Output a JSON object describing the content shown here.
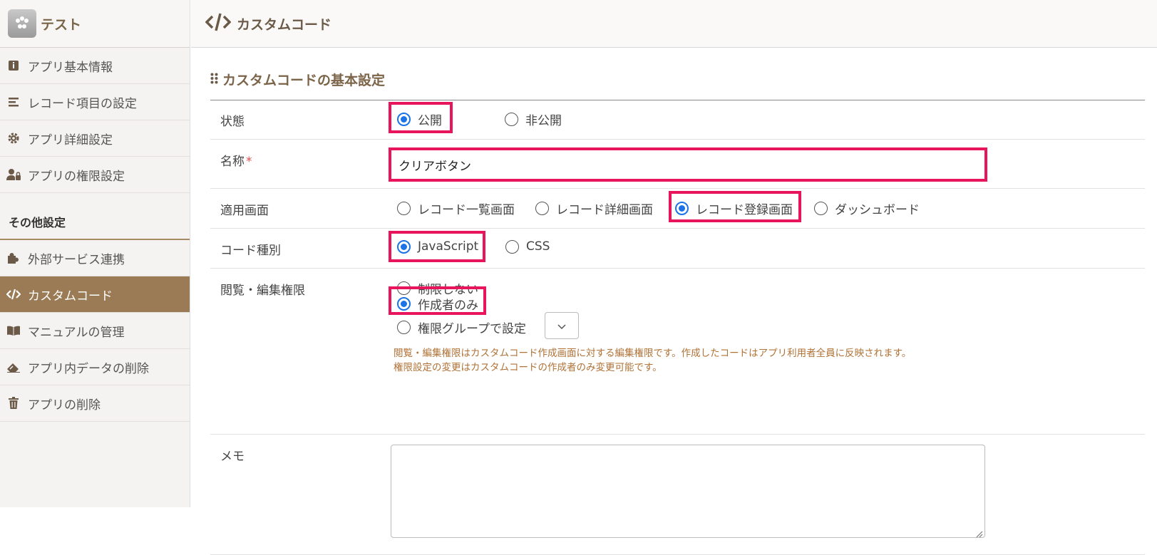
{
  "app": {
    "name": "テスト"
  },
  "sidebar": {
    "items": [
      {
        "label": "アプリ基本情報",
        "icon": "info-icon"
      },
      {
        "label": "レコード項目の設定",
        "icon": "list-icon"
      },
      {
        "label": "アプリ詳細設定",
        "icon": "gear-icon"
      },
      {
        "label": "アプリの権限設定",
        "icon": "user-lock-icon"
      }
    ],
    "other_heading": "その他設定",
    "other_items": [
      {
        "label": "外部サービス連携",
        "icon": "puzzle-icon"
      },
      {
        "label": "カスタムコード",
        "icon": "code-icon",
        "active": true
      },
      {
        "label": "マニュアルの管理",
        "icon": "book-icon"
      },
      {
        "label": "アプリ内データの削除",
        "icon": "eraser-icon"
      },
      {
        "label": "アプリの削除",
        "icon": "trash-icon"
      }
    ]
  },
  "topbar": {
    "title": "カスタムコード",
    "icon": "code-icon"
  },
  "section": {
    "title": "カスタムコードの基本設定"
  },
  "form": {
    "status": {
      "label": "状態",
      "options": [
        "公開",
        "非公開"
      ],
      "selected": "公開"
    },
    "name": {
      "label": "名称",
      "required_mark": "*",
      "value": "クリアボタン"
    },
    "screen": {
      "label": "適用画面",
      "options": [
        "レコード一覧画面",
        "レコード詳細画面",
        "レコード登録画面",
        "ダッシュボード"
      ],
      "selected": "レコード登録画面"
    },
    "code_type": {
      "label": "コード種別",
      "options": [
        "JavaScript",
        "CSS"
      ],
      "selected": "JavaScript"
    },
    "permission": {
      "label": "閲覧・編集権限",
      "options": [
        "制限しない",
        "作成者のみ",
        "権限グループで設定"
      ],
      "selected": "作成者のみ",
      "note_line1": "閲覧・編集権限はカスタムコード作成画面に対する編集権限です。作成したコードはアプリ利用者全員に反映されます。",
      "note_line2": "権限設定の変更はカスタムコードの作成者のみ変更可能です。"
    },
    "memo": {
      "label": "メモ",
      "value": ""
    }
  },
  "colors": {
    "accent": "#9a7b55",
    "highlight": "#e8145c",
    "radio": "#1a73e8",
    "note": "#b07236"
  }
}
